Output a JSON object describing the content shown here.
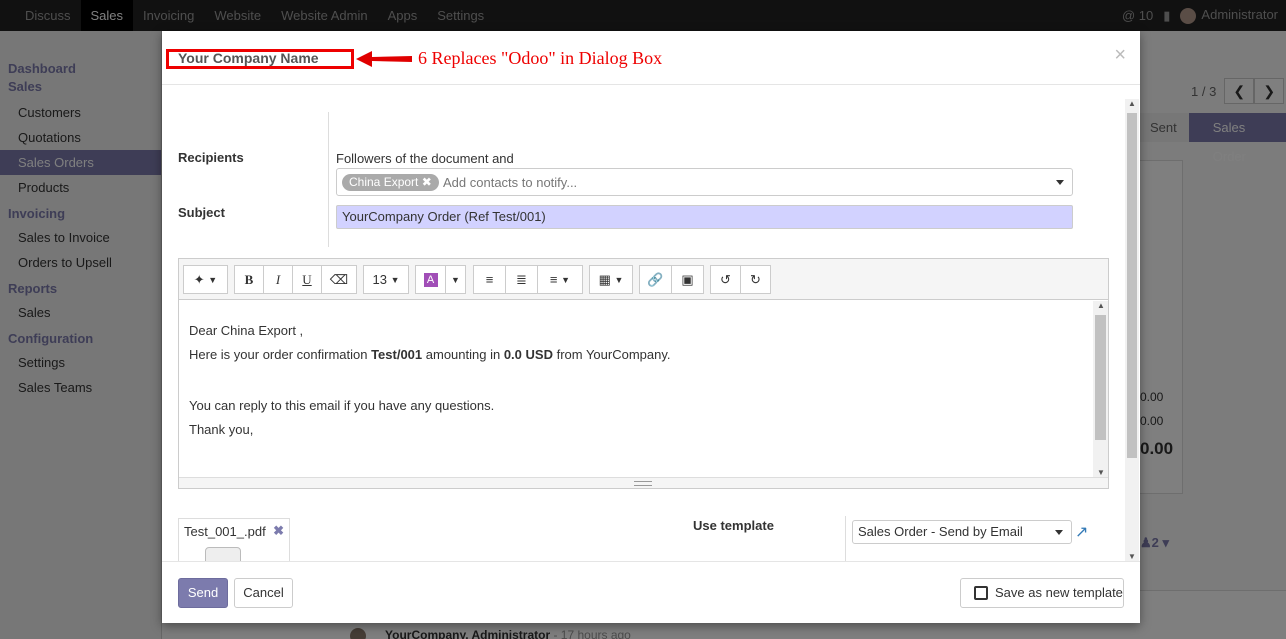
{
  "topbar": {
    "menu": [
      "Discuss",
      "Sales",
      "Invoicing",
      "Website",
      "Website Admin",
      "Apps",
      "Settings"
    ],
    "active": "Sales",
    "messages_count": "10",
    "user": "Administrator"
  },
  "sidebar": {
    "sections": [
      {
        "title": "Dashboard",
        "items": []
      },
      {
        "title": "Sales",
        "items": [
          "Customers",
          "Quotations",
          "Sales Orders",
          "Products"
        ]
      },
      {
        "title": "Invoicing",
        "items": [
          "Sales to Invoice",
          "Orders to Upsell"
        ]
      },
      {
        "title": "Reports",
        "items": [
          "Sales"
        ]
      },
      {
        "title": "Configuration",
        "items": [
          "Settings",
          "Sales Teams"
        ]
      }
    ],
    "active_item": "Sales Orders"
  },
  "background": {
    "pager": "1 / 3",
    "status_steps": [
      "Sent",
      "Sales Order"
    ],
    "amount_1": "0.00",
    "amount_2": "0.00",
    "amount_total": "0.00",
    "followers_count": "2",
    "chatter_author": "YourCompany, Administrator",
    "chatter_time": "- 17 hours ago"
  },
  "annotation": {
    "text": "6 Replaces \"Odoo\" in Dialog Box",
    "color": "#e00000"
  },
  "dialog": {
    "title": "Your Company Name",
    "close_glyph": "×",
    "recipients_label": "Recipients",
    "followers_text": "Followers of the document and",
    "recipient_tag": "China Export",
    "recipients_placeholder": "Add contacts to notify...",
    "subject_label": "Subject",
    "subject_value": "YourCompany Order (Ref Test/001)",
    "toolbar": {
      "font_size": "13"
    },
    "body": {
      "greeting": "Dear China Export ,",
      "line_pre": "Here is your order confirmation ",
      "order_ref": "Test/001",
      "line_mid": " amounting in ",
      "amount": "0.0 USD",
      "line_post": " from YourCompany.",
      "reply_line": "You can reply to this email if you have any questions.",
      "thanks": "Thank you,"
    },
    "attachment_name": "Test_001_.pdf",
    "use_template_label": "Use template",
    "template_value": "Sales Order - Send by Email",
    "send_label": "Send",
    "cancel_label": "Cancel",
    "save_template_label": "Save as new template"
  },
  "colors": {
    "accent": "#7c7bad",
    "subject_bg": "#d2d2ff"
  }
}
